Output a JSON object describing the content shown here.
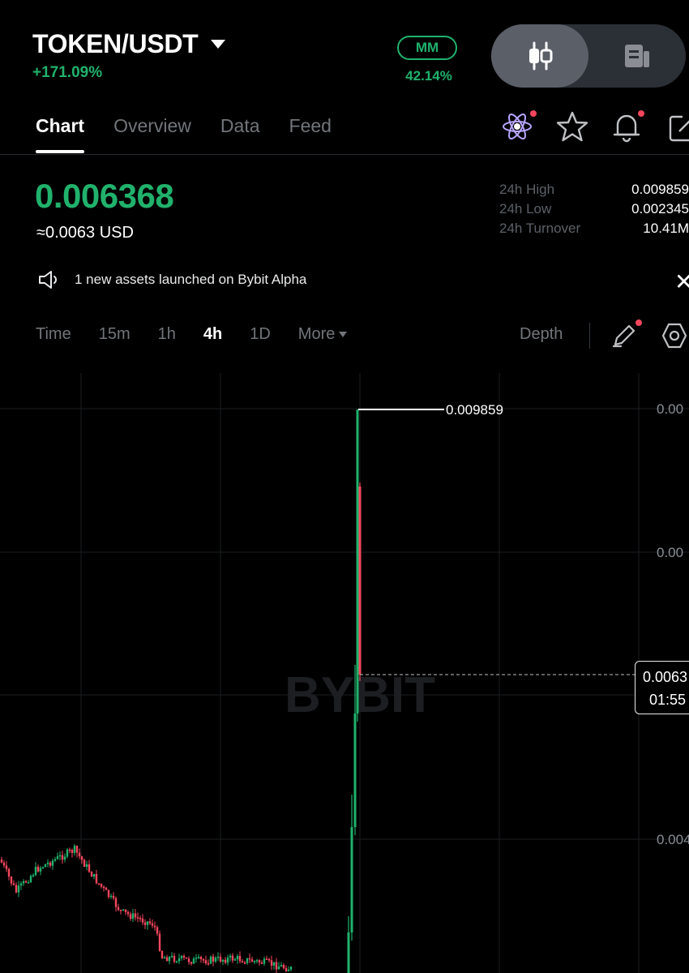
{
  "header": {
    "pair": "TOKEN/USDT",
    "change": "+171.09%",
    "mm_label": "MM",
    "mm_value": "42.14%",
    "view_modes": [
      "chart-candles-icon",
      "orderbook-icon"
    ]
  },
  "tabs": [
    {
      "label": "Chart",
      "active": true
    },
    {
      "label": "Overview",
      "active": false
    },
    {
      "label": "Data",
      "active": false
    },
    {
      "label": "Feed",
      "active": false
    }
  ],
  "toolbar_icons": [
    "atom-icon",
    "star-icon",
    "bell-icon",
    "share-icon"
  ],
  "price": {
    "last": "0.006368",
    "usd": "≈0.0063 USD"
  },
  "stats": [
    {
      "label": "24h High",
      "value": "0.009859"
    },
    {
      "label": "24h Low",
      "value": "0.002345"
    },
    {
      "label": "24h Turnover",
      "value": "10.41M"
    }
  ],
  "notice": {
    "text": "1 new  assets  launched on Bybit  Alpha"
  },
  "intervals": [
    {
      "label": "Time",
      "active": false
    },
    {
      "label": "15m",
      "active": false
    },
    {
      "label": "1h",
      "active": false
    },
    {
      "label": "4h",
      "active": true
    },
    {
      "label": "1D",
      "active": false
    },
    {
      "label": "More",
      "active": false
    }
  ],
  "depth_label": "Depth",
  "chart_data": {
    "type": "candlestick",
    "watermark": "BYBIT",
    "high_marker": "0.009859",
    "y_tick_labels": [
      "0.00",
      "0.00",
      "0.004"
    ],
    "current_price_tag": {
      "price": "0.0063",
      "countdown": "01:55"
    },
    "colors": {
      "up": "#20b26c",
      "down": "#f6465d"
    }
  }
}
